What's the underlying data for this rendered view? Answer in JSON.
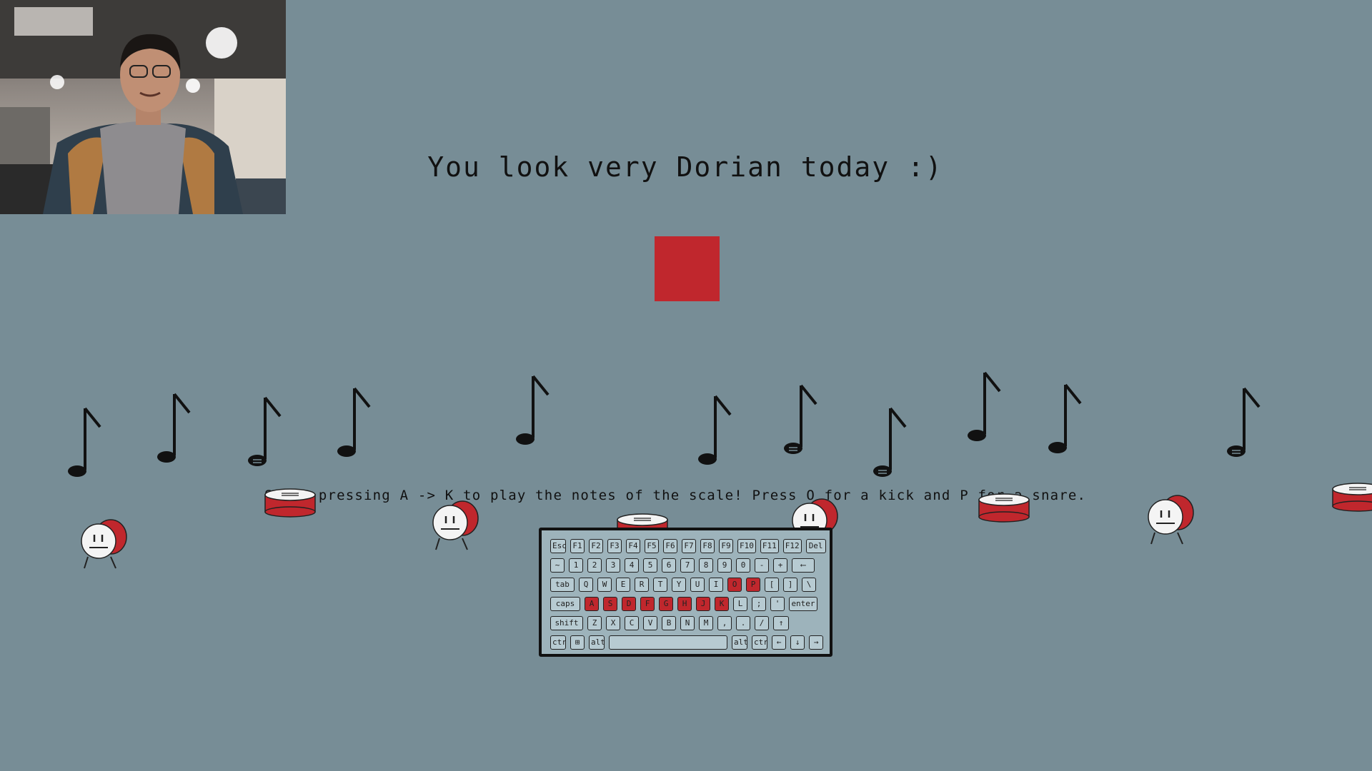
{
  "webcam": {
    "label": "webcam-feed"
  },
  "mood_text": "You look very Dorian today :)",
  "indicator": {
    "color": "#c0272d"
  },
  "instructions": "Start pressing A -> K to play the notes of the scale! Press O for a kick and P for a snare.",
  "keyboard": {
    "rows": [
      [
        "Esc",
        "F1",
        "F2",
        "F3",
        "F4",
        "F5",
        "F6",
        "F7",
        "F8",
        "F9",
        "F10",
        "F11",
        "F12",
        "Del"
      ],
      [
        "~",
        "1",
        "2",
        "3",
        "4",
        "5",
        "6",
        "7",
        "8",
        "9",
        "0",
        "-",
        "+",
        "⟵"
      ],
      [
        "tab",
        "Q",
        "W",
        "E",
        "R",
        "T",
        "Y",
        "U",
        "I",
        "O",
        "P",
        "[",
        "]",
        "\\"
      ],
      [
        "caps",
        "A",
        "S",
        "D",
        "F",
        "G",
        "H",
        "J",
        "K",
        "L",
        ";",
        "'",
        "enter"
      ],
      [
        "shift",
        "Z",
        "X",
        "C",
        "V",
        "B",
        "N",
        "M",
        ",",
        ".",
        "/",
        "↑"
      ],
      [
        "ctrl",
        "⊞",
        "alt",
        "",
        "alt",
        "ctrl",
        "←",
        "↓",
        "→"
      ]
    ],
    "active_keys": [
      "O",
      "P",
      "A",
      "S",
      "D",
      "F",
      "G",
      "H",
      "J",
      "K"
    ]
  },
  "colors": {
    "background": "#778d96",
    "accent_red": "#c0272d",
    "keyboard_body": "#9db3bb"
  }
}
